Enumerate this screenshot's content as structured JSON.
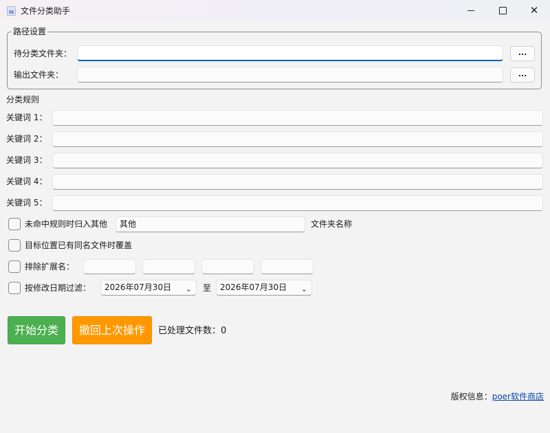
{
  "window": {
    "title": "文件分类助手",
    "close_glyph": "✕"
  },
  "paths": {
    "group_title": "路径设置",
    "source_label": "待分类文件夹：",
    "source_value": "",
    "output_label": "输出文件夹：",
    "output_value": "",
    "browse_label": "..."
  },
  "rules": {
    "section_title": "分类规则",
    "keywords": [
      {
        "label": "关键词 1：",
        "value": ""
      },
      {
        "label": "关键词 2：",
        "value": ""
      },
      {
        "label": "关键词 3：",
        "value": ""
      },
      {
        "label": "关键词 4：",
        "value": ""
      },
      {
        "label": "关键词 5：",
        "value": ""
      }
    ]
  },
  "options": {
    "unmatched": {
      "label": "未命中规则时归入其他",
      "checked": false,
      "folder_value": "其他",
      "suffix_label": "文件夹名称"
    },
    "overwrite": {
      "label": "目标位置已有同名文件时覆盖",
      "checked": false
    },
    "exclude_ext": {
      "label": "排除扩展名：",
      "checked": false,
      "values": [
        "",
        "",
        "",
        ""
      ]
    },
    "date_filter": {
      "label": "按修改日期过滤：",
      "checked": false,
      "from": "2026年07月30日",
      "to_label": "至",
      "to": "2026年07月30日"
    }
  },
  "actions": {
    "start_label": "开始分类",
    "undo_label": "撤回上次操作",
    "processed_label": "已处理文件数：",
    "processed_count": "0"
  },
  "footer": {
    "copyright_label": "版权信息：",
    "link_text": "poer软件商店"
  },
  "colors": {
    "start_button": "#4caf50",
    "undo_button": "#ff9800",
    "focus_accent": "#005fb8",
    "link": "#0645ad"
  },
  "icons": {
    "app": "app-icon",
    "chevron": "chevron-down-icon"
  }
}
